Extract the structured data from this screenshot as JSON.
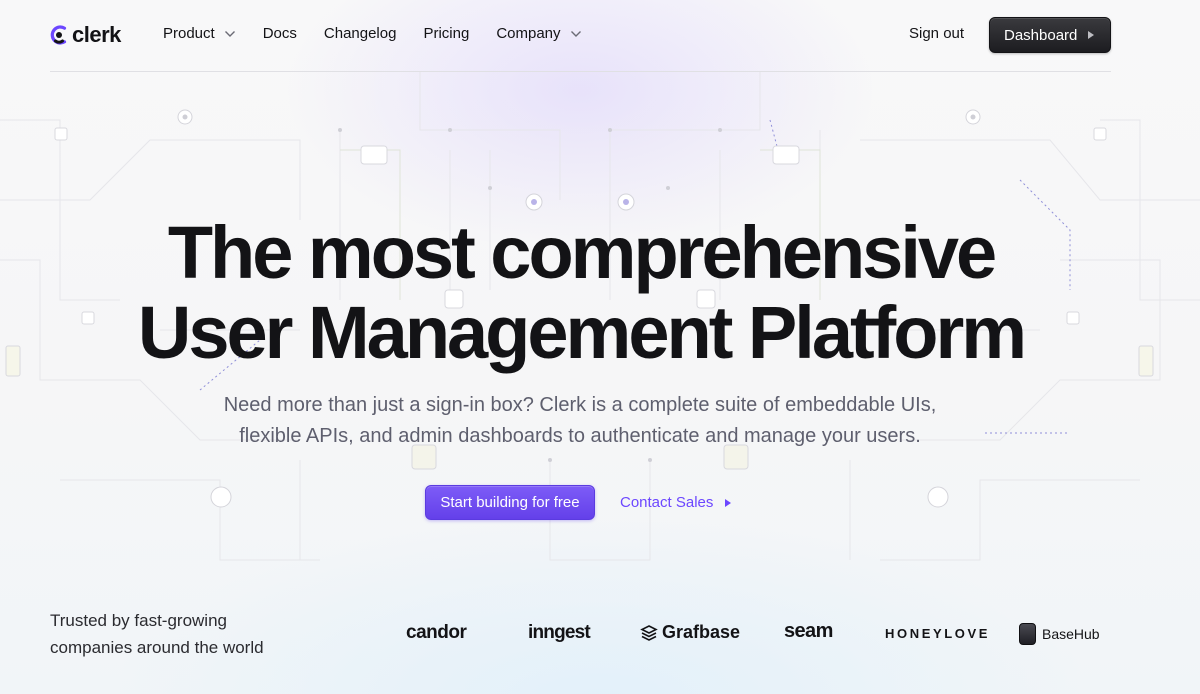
{
  "brand": {
    "name": "clerk",
    "accent": "#6C47FF"
  },
  "nav": {
    "items": [
      {
        "label": "Product",
        "dropdown": true
      },
      {
        "label": "Docs",
        "dropdown": false
      },
      {
        "label": "Changelog",
        "dropdown": false
      },
      {
        "label": "Pricing",
        "dropdown": false
      },
      {
        "label": "Company",
        "dropdown": true
      }
    ],
    "sign_out": "Sign out",
    "dashboard": "Dashboard"
  },
  "hero": {
    "title_line1": "The most comprehensive",
    "title_line2": "User Management Platform",
    "subtitle_line1": "Need more than just a sign-in box? Clerk is a complete suite of embeddable UIs,",
    "subtitle_line2": "flexible APIs, and admin dashboards to authenticate and manage your users.",
    "primary_cta": "Start building for free",
    "secondary_cta": "Contact Sales"
  },
  "trusted": {
    "line1": "Trusted by fast-growing",
    "line2": "companies around the world",
    "logos": [
      "candor",
      "inngest",
      "Grafbase",
      "seam",
      "HONEYLOVE",
      "BaseHub"
    ]
  }
}
